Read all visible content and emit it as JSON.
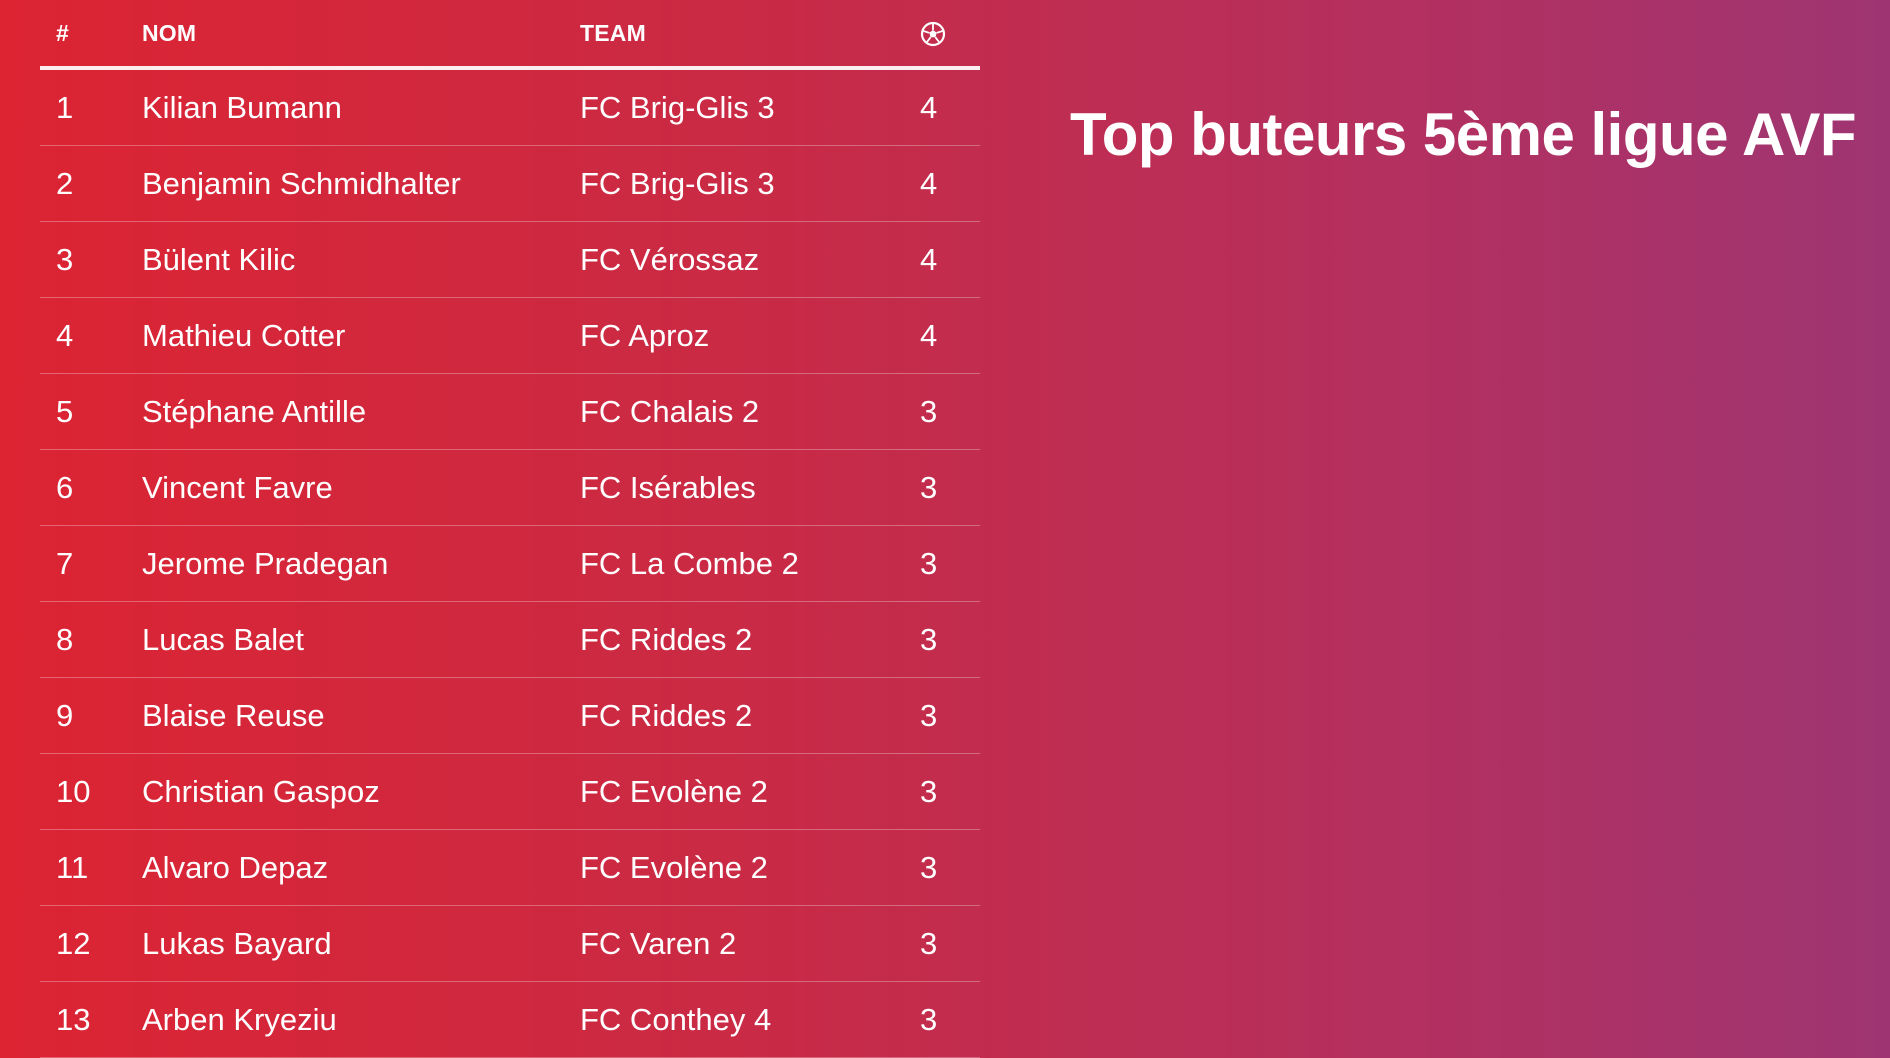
{
  "title": "Top buteurs 5ème ligue AVF",
  "table": {
    "headers": {
      "rank": "#",
      "name": "NOM",
      "team": "TEAM",
      "goals_icon": "soccer-ball-icon"
    },
    "rows": [
      {
        "rank": "1",
        "name": "Kilian Bumann",
        "team": "FC Brig-Glis 3",
        "goals": "4"
      },
      {
        "rank": "2",
        "name": "Benjamin Schmidhalter",
        "team": "FC Brig-Glis 3",
        "goals": "4"
      },
      {
        "rank": "3",
        "name": "Bülent Kilic",
        "team": "FC Vérossaz",
        "goals": "4"
      },
      {
        "rank": "4",
        "name": "Mathieu Cotter",
        "team": "FC Aproz",
        "goals": "4"
      },
      {
        "rank": "5",
        "name": "Stéphane Antille",
        "team": "FC Chalais 2",
        "goals": "3"
      },
      {
        "rank": "6",
        "name": "Vincent Favre",
        "team": "FC Isérables",
        "goals": "3"
      },
      {
        "rank": "7",
        "name": "Jerome Pradegan",
        "team": "FC La Combe 2",
        "goals": "3"
      },
      {
        "rank": "8",
        "name": "Lucas Balet",
        "team": "FC Riddes 2",
        "goals": "3"
      },
      {
        "rank": "9",
        "name": "Blaise Reuse",
        "team": "FC Riddes 2",
        "goals": "3"
      },
      {
        "rank": "10",
        "name": "Christian Gaspoz",
        "team": "FC Evolène 2",
        "goals": "3"
      },
      {
        "rank": "11",
        "name": "Alvaro Depaz",
        "team": "FC Evolène 2",
        "goals": "3"
      },
      {
        "rank": "12",
        "name": "Lukas Bayard",
        "team": "FC Varen 2",
        "goals": "3"
      },
      {
        "rank": "13",
        "name": "Arben Kryeziu",
        "team": "FC Conthey 4",
        "goals": "3"
      }
    ]
  },
  "colors": {
    "gradient_start": "#dc2433",
    "gradient_end": "#9e3572",
    "text": "#ffffff"
  }
}
